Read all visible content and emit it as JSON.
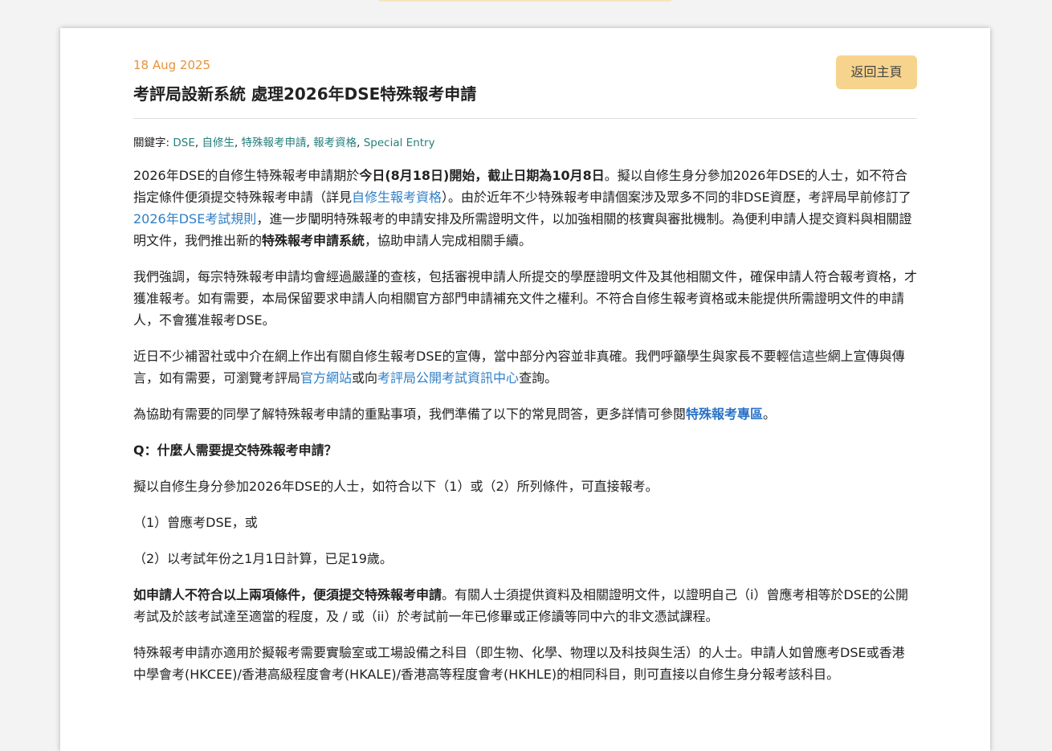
{
  "article": {
    "date": "18 Aug 2025",
    "title": "考評局設新系統 處理2026年DSE特殊報考申請",
    "back_button_label": "返回主頁",
    "keywords_label": "關鍵字:",
    "keywords": [
      "DSE",
      "自修生",
      "特殊報考申請",
      "報考資格",
      "Special Entry"
    ],
    "keyword_separator": ", ",
    "p1": {
      "t1": "2026年DSE的自修生特殊報考申請期於",
      "b1": "今日(8月18日)開始，截止日期為10月8日",
      "t2": "。擬以自修生身分參加2026年DSE的人士，如不符合指定條件便須提交特殊報考申請（詳見",
      "link1": "自修生報考資格",
      "t3": "）。由於近年不少特殊報考申請個案涉及眾多不同的非DSE資歷，考評局早前修訂了",
      "link2": "2026年DSE考試規則",
      "t4": "，進一步闡明特殊報考的申請安排及所需證明文件，以加強相關的核實與審批機制。為便利申請人提交資料與相關證明文件，我們推出新的",
      "b2": "特殊報考申請系統",
      "t5": "，協助申請人完成相關手續。"
    },
    "p2": "我們強調，每宗特殊報考申請均會經過嚴謹的查核，包括審視申請人所提交的學歷證明文件及其他相關文件，確保申請人符合報考資格，才獲准報考。如有需要，本局保留要求申請人向相關官方部門申請補充文件之權利。不符合自修生報考資格或未能提供所需證明文件的申請人，不會獲准報考DSE。",
    "p3": {
      "t1": "近日不少補習社或中介在網上作出有關自修生報考DSE的宣傳，當中部分內容並非真確。我們呼籲學生與家長不要輕信這些網上宣傳與傳言，如有需要，可瀏覽考評局",
      "link1": "官方網站",
      "t2": "或向",
      "link2": "考評局公開考試資訊中心",
      "t3": "查詢。"
    },
    "p4": {
      "t1": "為協助有需要的同學了解特殊報考申請的重點事項，我們準備了以下的常見問答，更多詳情可參閱",
      "link1": "特殊報考專區",
      "t2": "。"
    },
    "q1": "Q：什麼人需要提交特殊報考申請？",
    "p5": "擬以自修生身分參加2026年DSE的人士，如符合以下（1）或（2）所列條件，可直接報考。",
    "p6": "（1）曾應考DSE，或",
    "p7": "（2）以考試年份之1月1日計算，已足19歲。",
    "p8": {
      "b1": "如申請人不符合以上兩項條件，便須提交特殊報考申請",
      "t1": "。有關人士須提供資料及相關證明文件，以證明自己（i）曾應考相等於DSE的公開考試及於該考試達至適當的程度，及 / 或（ii）於考試前一年已修畢或正修讀等同中六的非文憑試課程。"
    },
    "p9": "特殊報考申請亦適用於擬報考需要實驗室或工場設備之科目（即生物、化學、物理以及科技與生活）的人士。申請人如曾應考DSE或香港中學會考(HKCEE)/香港高級程度會考(HKALE)/香港高等程度會考(HKHLE)的相同科目，則可直接以自修生身分報考該科目。"
  }
}
